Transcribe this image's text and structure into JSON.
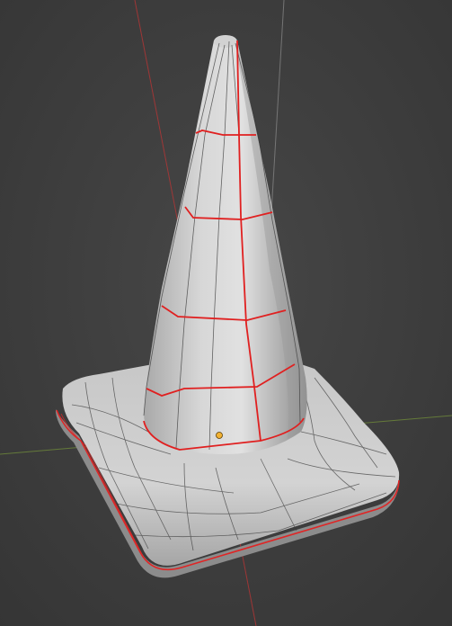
{
  "viewport": {
    "background": "#3b3b3b",
    "x_axis_color": "#7a9a3a",
    "y_axis_color": "#c83a3a",
    "z_axis_color": "#8f8f8f",
    "mesh_color": "#c9c9c9",
    "wire_color": "#2a2a2a",
    "seam_color": "#e02020",
    "origin_color": "#f2b233",
    "object": "cone-mesh"
  }
}
